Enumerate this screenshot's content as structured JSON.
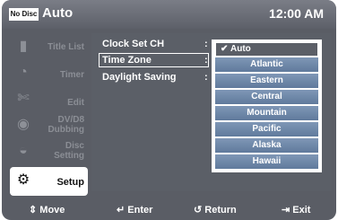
{
  "header": {
    "disc_status": "No Disc",
    "title": "Auto",
    "clock": "12:00 AM"
  },
  "sidebar": {
    "items": [
      {
        "label": "Title List",
        "icon": "title-list-icon"
      },
      {
        "label": "Timer",
        "icon": "timer-icon"
      },
      {
        "label": "Edit",
        "icon": "edit-icon"
      },
      {
        "label": "DV/D8 Dubbing",
        "icon": "dubbing-icon"
      },
      {
        "label": "Disc Setting",
        "icon": "disc-setting-icon"
      },
      {
        "label": "Setup",
        "icon": "gear-icon",
        "active": true
      }
    ]
  },
  "panel": {
    "rows": [
      {
        "label": "Clock Set CH"
      },
      {
        "label": "Time Zone",
        "selected": true
      },
      {
        "label": "Daylight Saving"
      }
    ]
  },
  "dropdown": {
    "options": [
      "Auto",
      "Atlantic",
      "Eastern",
      "Central",
      "Mountain",
      "Pacific",
      "Alaska",
      "Hawaii"
    ],
    "selected": "Auto"
  },
  "footer": {
    "move": "Move",
    "enter": "Enter",
    "return": "Return",
    "exit": "Exit"
  }
}
